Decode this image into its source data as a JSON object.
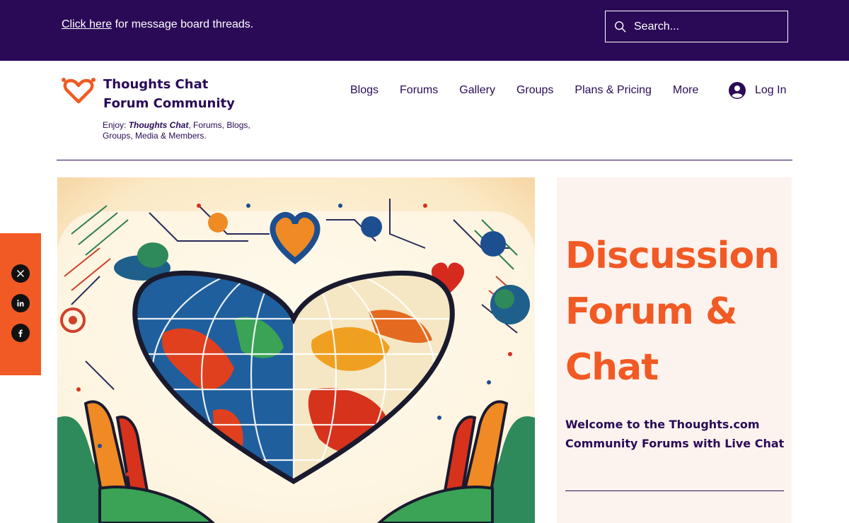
{
  "topbar": {
    "link_text": "Click here",
    "message_rest": " for message board threads.",
    "search_placeholder": "Search..."
  },
  "header": {
    "brand_line1": "Thoughts Chat",
    "brand_line2": "Forum Community",
    "tagline_prefix": "Enjoy: ",
    "tagline_emph": "Thoughts Chat",
    "tagline_rest": ", Forums, Blogs, Groups, Media & Members."
  },
  "nav": {
    "items": [
      "Blogs",
      "Forums",
      "Gallery",
      "Groups",
      "Plans & Pricing",
      "More"
    ],
    "login_label": "Log In"
  },
  "social": [
    "x-icon",
    "linkedin-icon",
    "facebook-icon"
  ],
  "hero": {
    "title_line1": "Discussion",
    "title_line2": "Forum &",
    "title_line3": "Chat",
    "welcome": "Welcome to the Thoughts.com Community Forums with Live Chat"
  },
  "colors": {
    "brand_purple": "#2a0a57",
    "accent_orange": "#f15a24",
    "panel_bg": "#fdf3ee"
  }
}
